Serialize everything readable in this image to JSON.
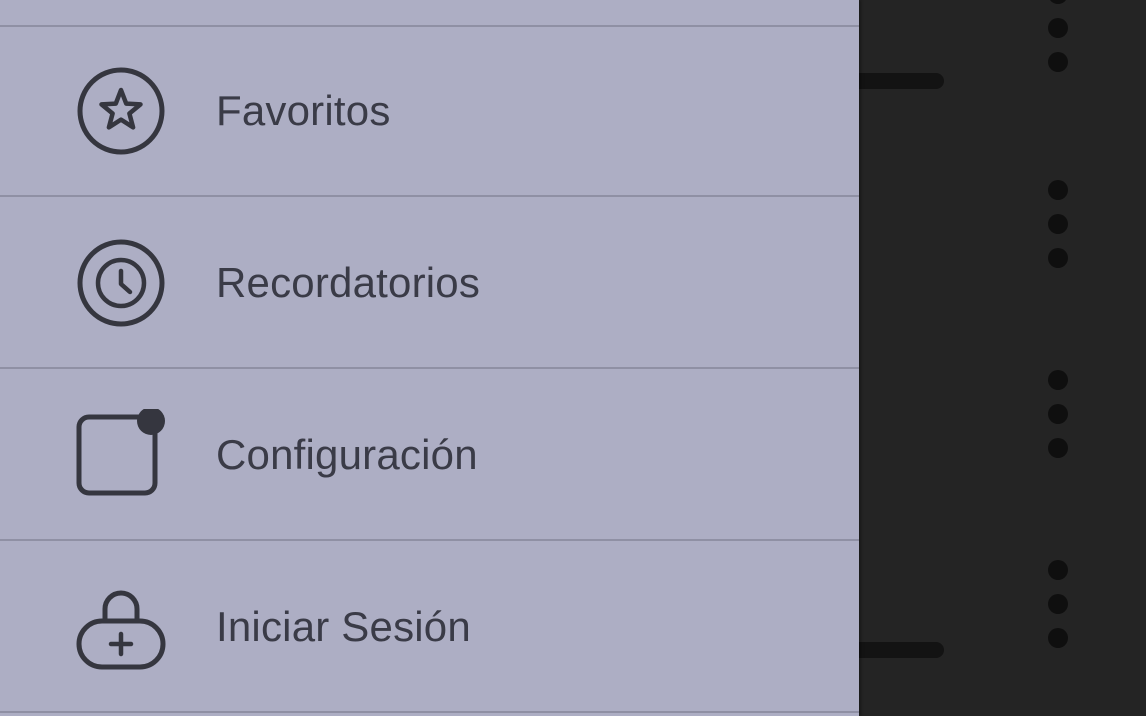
{
  "drawer": {
    "items": [
      {
        "label": "Favoritos",
        "icon": "star-circle-icon"
      },
      {
        "label": "Recordatorios",
        "icon": "clock-circle-icon"
      },
      {
        "label": "Configuración",
        "icon": "settings-square-icon"
      },
      {
        "label": "Iniciar Sesión",
        "icon": "lock-plus-icon"
      }
    ]
  },
  "colors": {
    "drawer_background": "#adaec4",
    "divider": "#8f90a4",
    "text": "#3a3b47",
    "backdrop": "#242424"
  }
}
